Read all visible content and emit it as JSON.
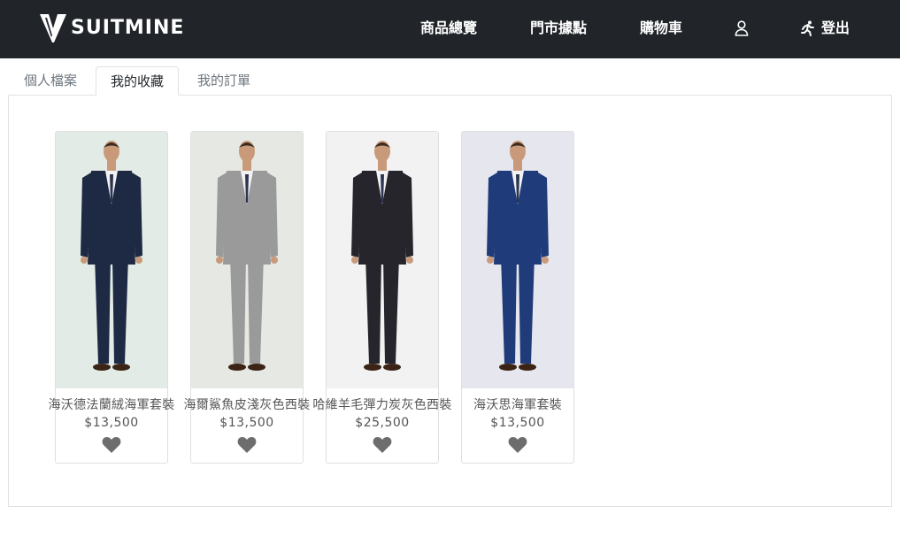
{
  "brand": {
    "name": "SUITMINE"
  },
  "nav": {
    "products": "商品總覽",
    "stores": "門市據點",
    "cart": "購物車",
    "logout": "登出"
  },
  "tabs": [
    {
      "label": "個人檔案",
      "active": false
    },
    {
      "label": "我的收藏",
      "active": true
    },
    {
      "label": "我的訂單",
      "active": false
    }
  ],
  "favorites": [
    {
      "name": "海沃德法蘭絨海軍套裝",
      "price": "$13,500",
      "suit_color": "#1e2a44",
      "bg": "#e3ebe6"
    },
    {
      "name": "海爾鯊魚皮淺灰色西裝",
      "price": "$13,500",
      "suit_color": "#9a9a9a",
      "bg": "#e6e9e3"
    },
    {
      "name": "哈維羊毛彈力炭灰色西裝",
      "price": "$25,500",
      "suit_color": "#25252b",
      "bg": "#f2f2f3"
    },
    {
      "name": "海沃思海軍套裝",
      "price": "$13,500",
      "suit_color": "#1f3b7a",
      "bg": "#e6e7ee"
    }
  ],
  "colors": {
    "navbar": "#212529",
    "heart": "#6d6d6d"
  },
  "icons": [
    "brand-logo-icon",
    "user-icon",
    "running-person-icon",
    "heart-icon"
  ]
}
